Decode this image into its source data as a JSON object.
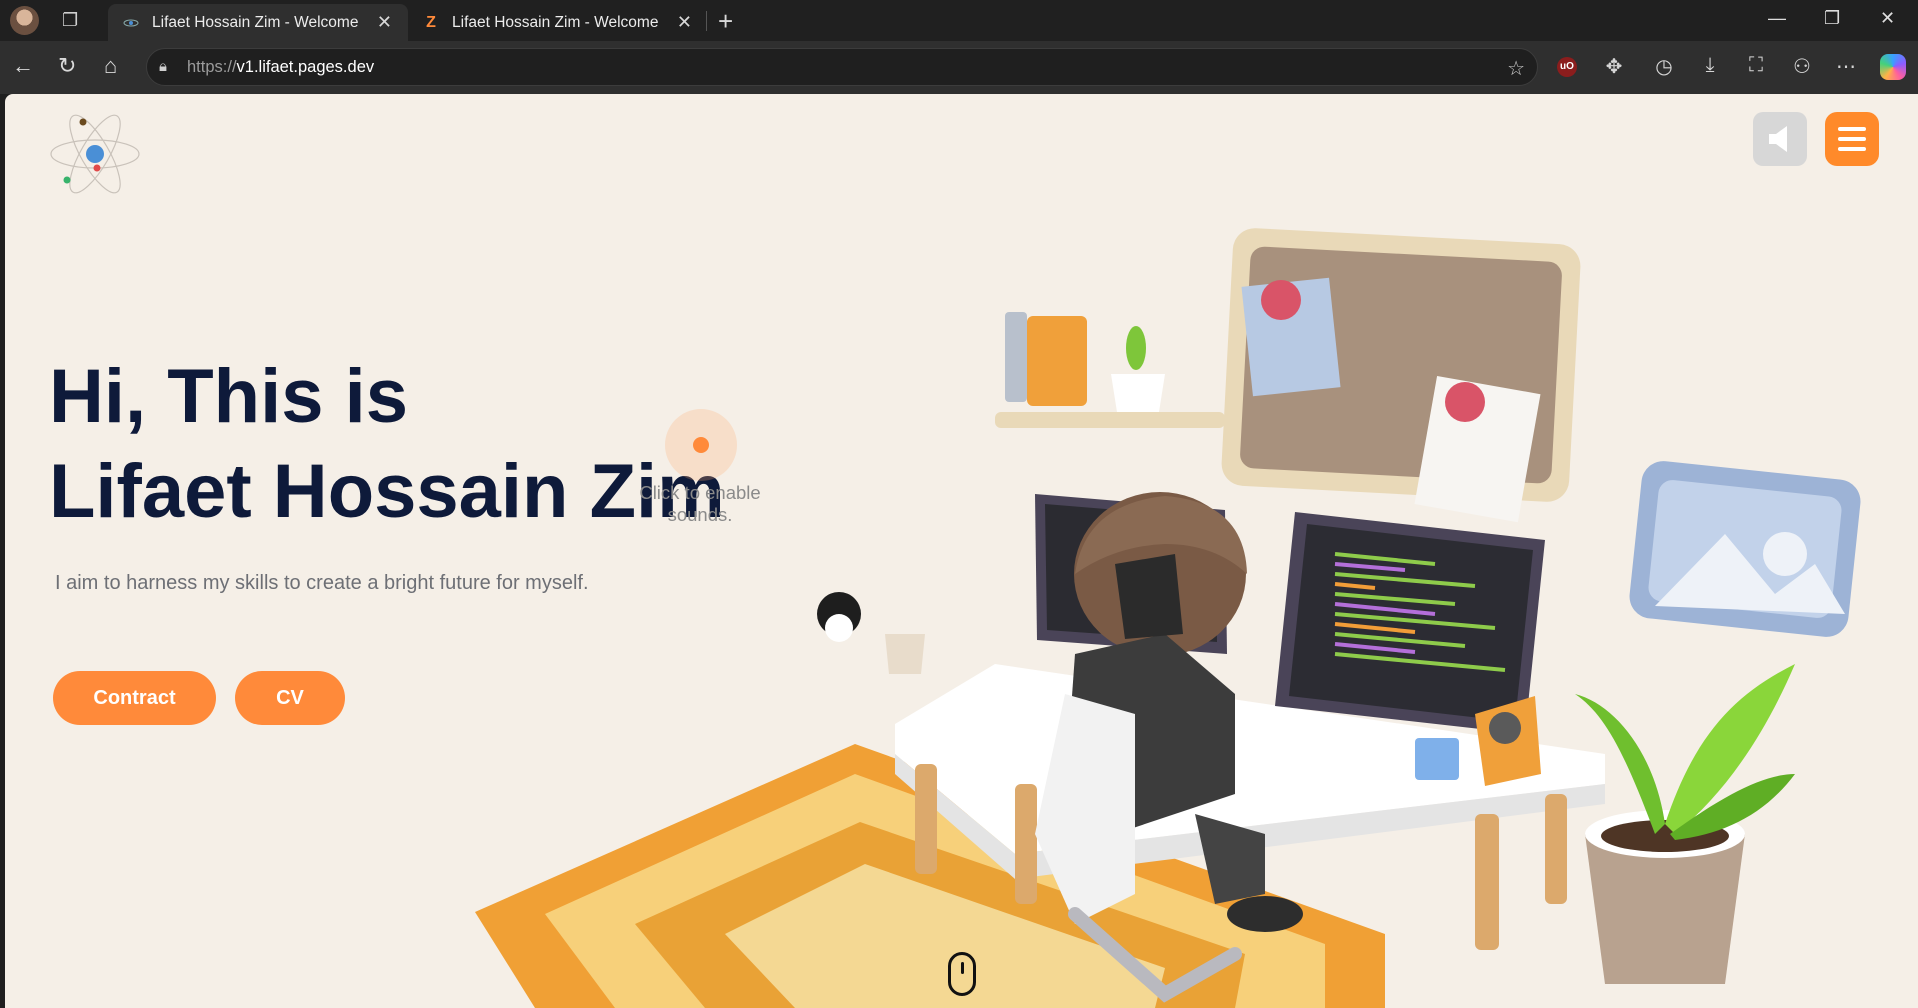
{
  "browser": {
    "tabs": [
      {
        "title": "Lifaet Hossain Zim - Welcome",
        "active": true
      },
      {
        "title": "Lifaet Hossain Zim - Welcome",
        "active": false
      }
    ],
    "url_protocol": "https://",
    "url_host": "v1.lifaet.pages.dev"
  },
  "page": {
    "hero_line1": "Hi, This is",
    "hero_line2": "Lifaet Hossain Zim",
    "subtitle": "I aim to harness my skills to create a bright future for myself.",
    "buttons": {
      "contract": "Contract",
      "cv": "CV"
    },
    "sound_hint": "Click to enable sounds."
  },
  "colors": {
    "accent": "#ff8a3a",
    "heading": "#0e1a3a",
    "background": "#f5efe7"
  },
  "icons": [
    "atom-logo-icon",
    "speaker-icon",
    "hamburger-menu-icon",
    "mouse-scroll-icon"
  ]
}
